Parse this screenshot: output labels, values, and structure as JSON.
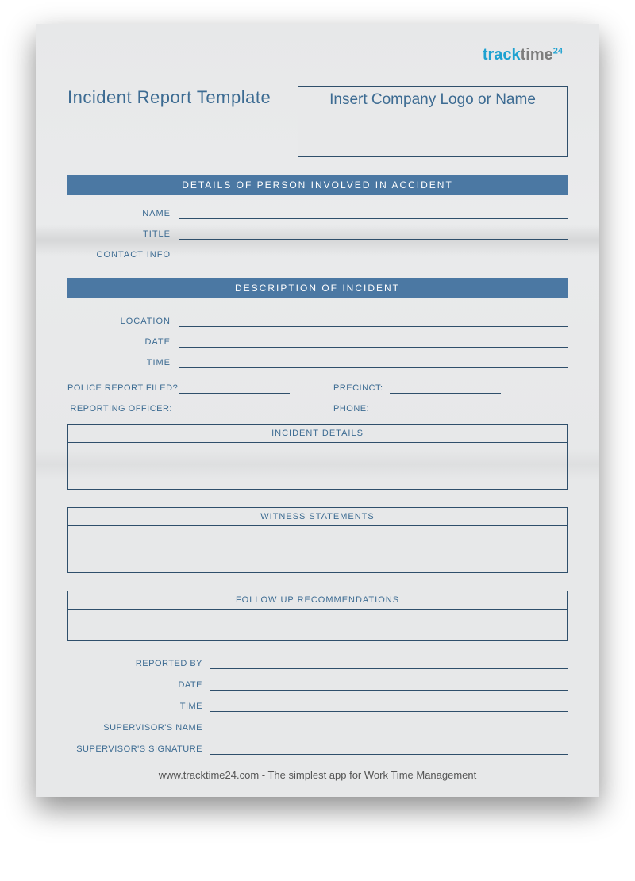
{
  "brand": {
    "track": "track",
    "time": "time",
    "suffix": "24"
  },
  "title": "Incident Report Template",
  "logoPlaceholder": "Insert Company Logo or Name",
  "section1": {
    "heading": "DETAILS OF PERSON INVOLVED IN ACCIDENT",
    "fields": {
      "name": "NAME",
      "title": "TITLE",
      "contact": "CONTACT INFO"
    }
  },
  "section2": {
    "heading": "DESCRIPTION OF INCIDENT",
    "fields": {
      "location": "LOCATION",
      "date": "DATE",
      "time": "TIME"
    },
    "police": {
      "filed": "POLICE REPORT FILED?",
      "precinct": "PRECINCT:",
      "officer": "REPORTING OFFICER:",
      "phone": "PHONE:"
    },
    "boxes": {
      "details": "INCIDENT DETAILS",
      "witness": "WITNESS STATEMENTS",
      "followup": "FOLLOW UP RECOMMENDATIONS"
    }
  },
  "footerFields": {
    "reportedBy": "REPORTED BY",
    "date": "DATE",
    "time": "TIME",
    "supervisorName": "SUPERVISOR'S NAME",
    "supervisorSig": "SUPERVISOR'S SIGNATURE"
  },
  "pageFooter": "www.tracktime24.com - The simplest app for Work Time Management"
}
